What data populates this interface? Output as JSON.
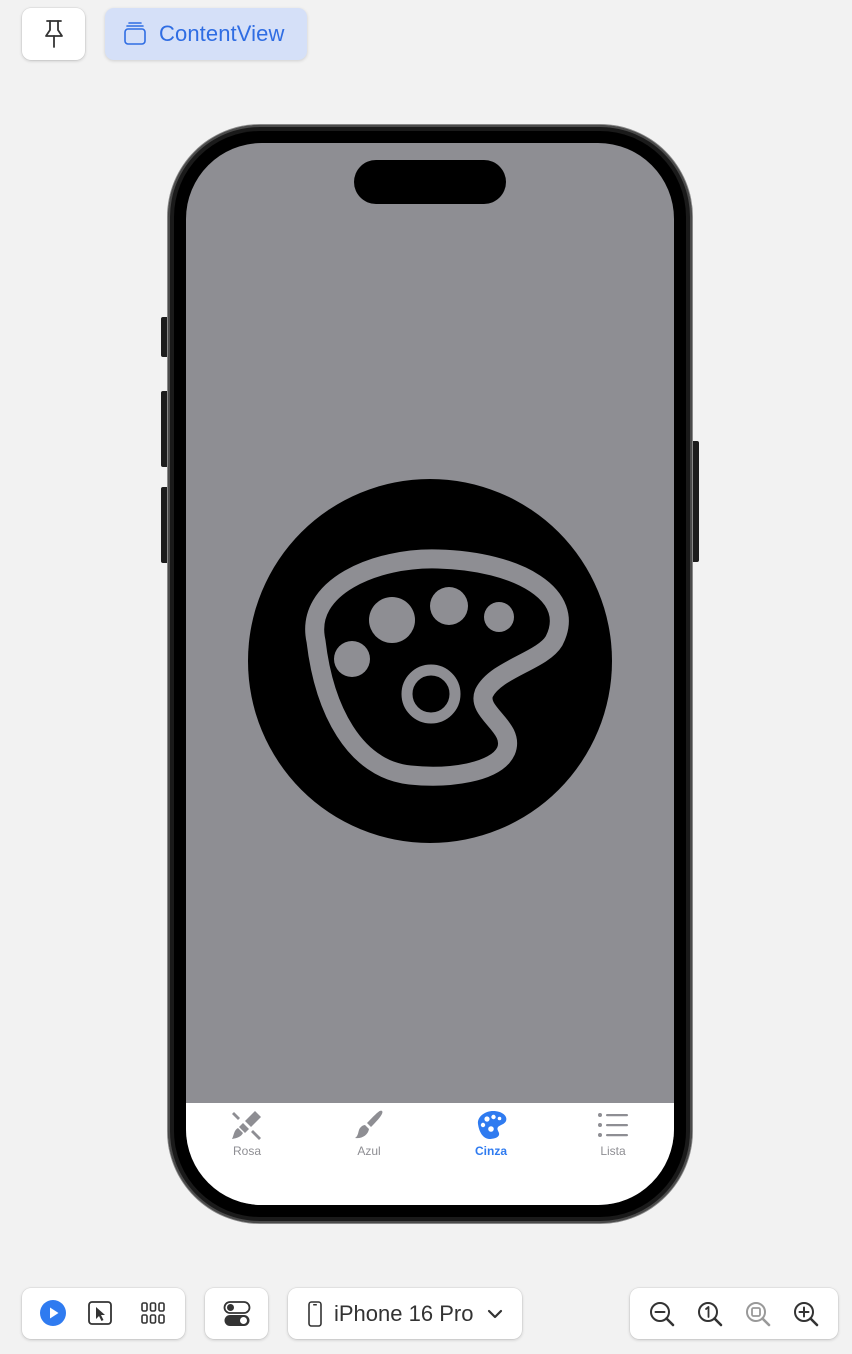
{
  "toolbar": {
    "pin_icon": "pin-icon",
    "tab_icon": "stacked-windows-icon",
    "tab_label": "ContentView"
  },
  "device": {
    "name": "iPhone 16 Pro"
  },
  "screen": {
    "background_color": "#8e8e93",
    "center_icon": "paintpalette-circle-icon"
  },
  "tabbar": {
    "items": [
      {
        "label": "Rosa",
        "icon": "paintbrush-pointed-icon",
        "active": false
      },
      {
        "label": "Azul",
        "icon": "paintbrush-icon",
        "active": false
      },
      {
        "label": "Cinza",
        "icon": "paintpalette-icon",
        "active": true
      },
      {
        "label": "Lista",
        "icon": "list-bullet-icon",
        "active": false
      }
    ],
    "active_color": "#2f7bf0",
    "inactive_color": "#8e8e93"
  },
  "bottom_toolbar": {
    "live_icon": "play-circle-icon",
    "select_icon": "cursor-select-icon",
    "grid_icon": "grid-icon",
    "variants_icon": "toggles-icon",
    "device_icon": "iphone-icon",
    "chevron_icon": "chevron-down-icon",
    "zoom_out_icon": "zoom-out-icon",
    "zoom_actual_icon": "zoom-actual-size-icon",
    "zoom_fit_icon": "zoom-to-fit-icon",
    "zoom_in_icon": "zoom-in-icon"
  }
}
